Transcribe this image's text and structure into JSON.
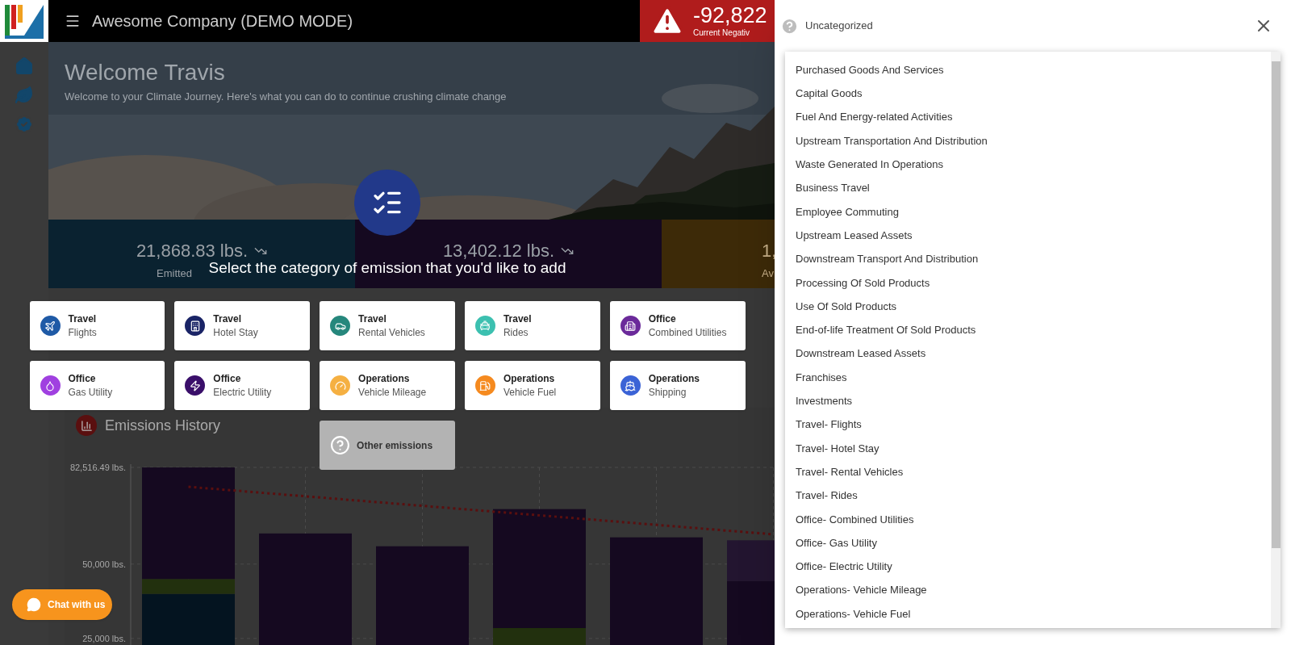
{
  "header": {
    "title": "Awesome Company (DEMO MODE)",
    "alert": {
      "value": "-92,822",
      "label": "Current Negativ"
    }
  },
  "hero": {
    "title": "Welcome Travis",
    "subtitle": "Welcome to your Climate Journey. Here's what you can do to continue crushing climate change"
  },
  "stats": [
    {
      "value": "21,868.83 lbs.",
      "label": "Emitted",
      "color": "#0a2230"
    },
    {
      "value": "13,402.12 lbs.",
      "color": "#150920"
    },
    {
      "value": "1,",
      "label": "Av",
      "color": "#3d2a08"
    }
  ],
  "history": {
    "title": "Emissions History",
    "chart_data": {
      "type": "bar",
      "stacked": true,
      "grid": true,
      "ylim": [
        0,
        82516.49
      ],
      "yticks": [
        {
          "value": 82516.49,
          "label": "82,516.49 lbs."
        },
        {
          "value": 50000,
          "label": "50,000 lbs."
        },
        {
          "value": 25000,
          "label": "25,000 lbs."
        }
      ],
      "series": [
        {
          "color": "#041420",
          "values": [
            40000,
            0,
            0,
            0,
            0,
            0
          ]
        },
        {
          "color": "#22300e",
          "values": [
            5000,
            0,
            0,
            28500,
            0,
            0
          ]
        },
        {
          "color": "#150920",
          "values": [
            37500,
            60300,
            56000,
            40000,
            59000,
            44300
          ]
        },
        {
          "color": "#231530",
          "values": [
            0,
            0,
            0,
            0,
            0,
            13700
          ]
        },
        {
          "type": "line",
          "line_style": "dashed",
          "color": "#5a0f0f",
          "values": [
            76000,
            72800,
            69600,
            66400,
            63200,
            60000
          ]
        }
      ]
    }
  },
  "dialog": {
    "title": "Select the category of emission that you'd like to add",
    "options": [
      {
        "kind": "category",
        "category": "Travel",
        "subcategory": "Flights",
        "color": "#1f5aa6"
      },
      {
        "kind": "category",
        "category": "Travel",
        "subcategory": "Hotel Stay",
        "color": "#1a2466"
      },
      {
        "kind": "category",
        "category": "Travel",
        "subcategory": "Rental Vehicles",
        "color": "#26877c"
      },
      {
        "kind": "category",
        "category": "Travel",
        "subcategory": "Rides",
        "color": "#3cc0b0"
      },
      {
        "kind": "category",
        "category": "Office",
        "subcategory": "Combined Utilities",
        "color": "#6b2a9a"
      },
      {
        "kind": "category",
        "category": "Office",
        "subcategory": "Gas Utility",
        "color": "#a040e0"
      },
      {
        "kind": "category",
        "category": "Office",
        "subcategory": "Electric Utility",
        "color": "#3a0f6a"
      },
      {
        "kind": "category",
        "category": "Operations",
        "subcategory": "Vehicle Mileage",
        "color": "#f5b042"
      },
      {
        "kind": "category",
        "category": "Operations",
        "subcategory": "Vehicle Fuel",
        "color": "#f58a1f"
      },
      {
        "kind": "category",
        "category": "Operations",
        "subcategory": "Shipping",
        "color": "#3b63d6"
      },
      {
        "kind": "other",
        "label": "Other emissions"
      }
    ]
  },
  "chat_button": {
    "label": "Chat with us"
  },
  "panel": {
    "title": "Uncategorized",
    "items": [
      "Purchased Goods And Services",
      "Capital Goods",
      "Fuel And Energy-related Activities",
      "Upstream Transportation And Distribution",
      "Waste Generated In Operations",
      "Business Travel",
      "Employee Commuting",
      "Upstream Leased Assets",
      "Downstream Transport And Distribution",
      "Processing Of Sold Products",
      "Use Of Sold Products",
      "End-of-life Treatment Of Sold Products",
      "Downstream Leased Assets",
      "Franchises",
      "Investments",
      "Travel- Flights",
      "Travel- Hotel Stay",
      "Travel- Rental Vehicles",
      "Travel- Rides",
      "Office- Combined Utilities",
      "Office- Gas Utility",
      "Office- Electric Utility",
      "Operations- Vehicle Mileage",
      "Operations- Vehicle Fuel"
    ]
  }
}
